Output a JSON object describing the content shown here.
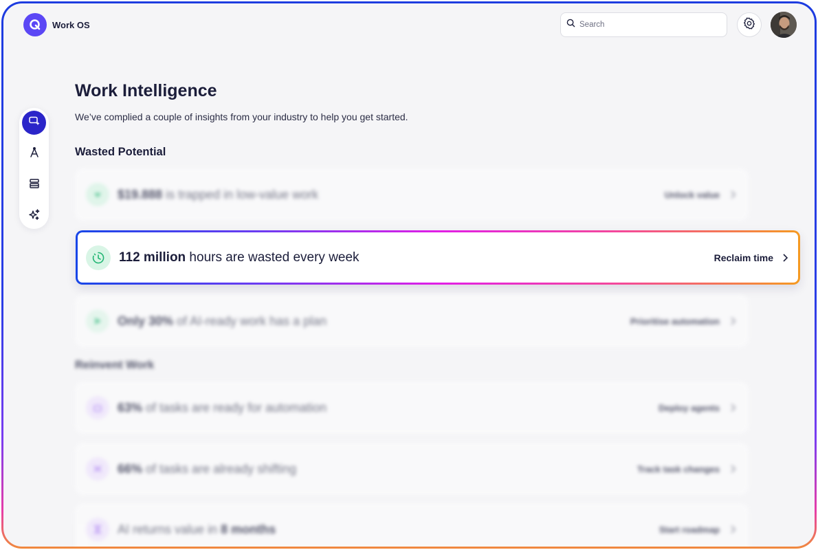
{
  "app": {
    "title": "Work OS"
  },
  "header": {
    "search_placeholder": "Search"
  },
  "page": {
    "title": "Work Intelligence",
    "subtitle": "We’ve complied a couple of insights from your industry to help you get started."
  },
  "sections": [
    {
      "title": "Wasted Potential"
    },
    {
      "title": "Reinvent Work"
    }
  ],
  "insights": {
    "value_trapped": {
      "strong": "$19.888",
      "rest": " is trapped in low-value work",
      "action": "Unlock value"
    },
    "hours_wasted": {
      "strong": "112 million",
      "rest": " hours are wasted every week",
      "action": "Reclaim time"
    },
    "ai_ready": {
      "strong": "Only 30%",
      "rest": " of AI-ready work has a plan",
      "action": "Prioritise automation"
    },
    "automation_ready": {
      "strong": "63%",
      "rest": " of tasks are ready for automation",
      "action": "Deploy agents"
    },
    "tasks_shifting": {
      "strong": "66%",
      "rest": " of tasks are already shifting",
      "action": "Track task changes"
    },
    "ai_returns": {
      "pre": "AI returns value in ",
      "strong": "8 months",
      "action": "Start roadmap"
    }
  },
  "colors": {
    "accent": "#2b25c9",
    "logo": "#5b47f5",
    "green": "#22b573",
    "purple": "#a06ef2"
  },
  "icons": {
    "logo": "logo-icon",
    "search": "search-icon",
    "settings": "gear-icon",
    "rail": [
      "insight-icon",
      "compass-icon",
      "layers-icon",
      "sparkles-icon"
    ]
  }
}
